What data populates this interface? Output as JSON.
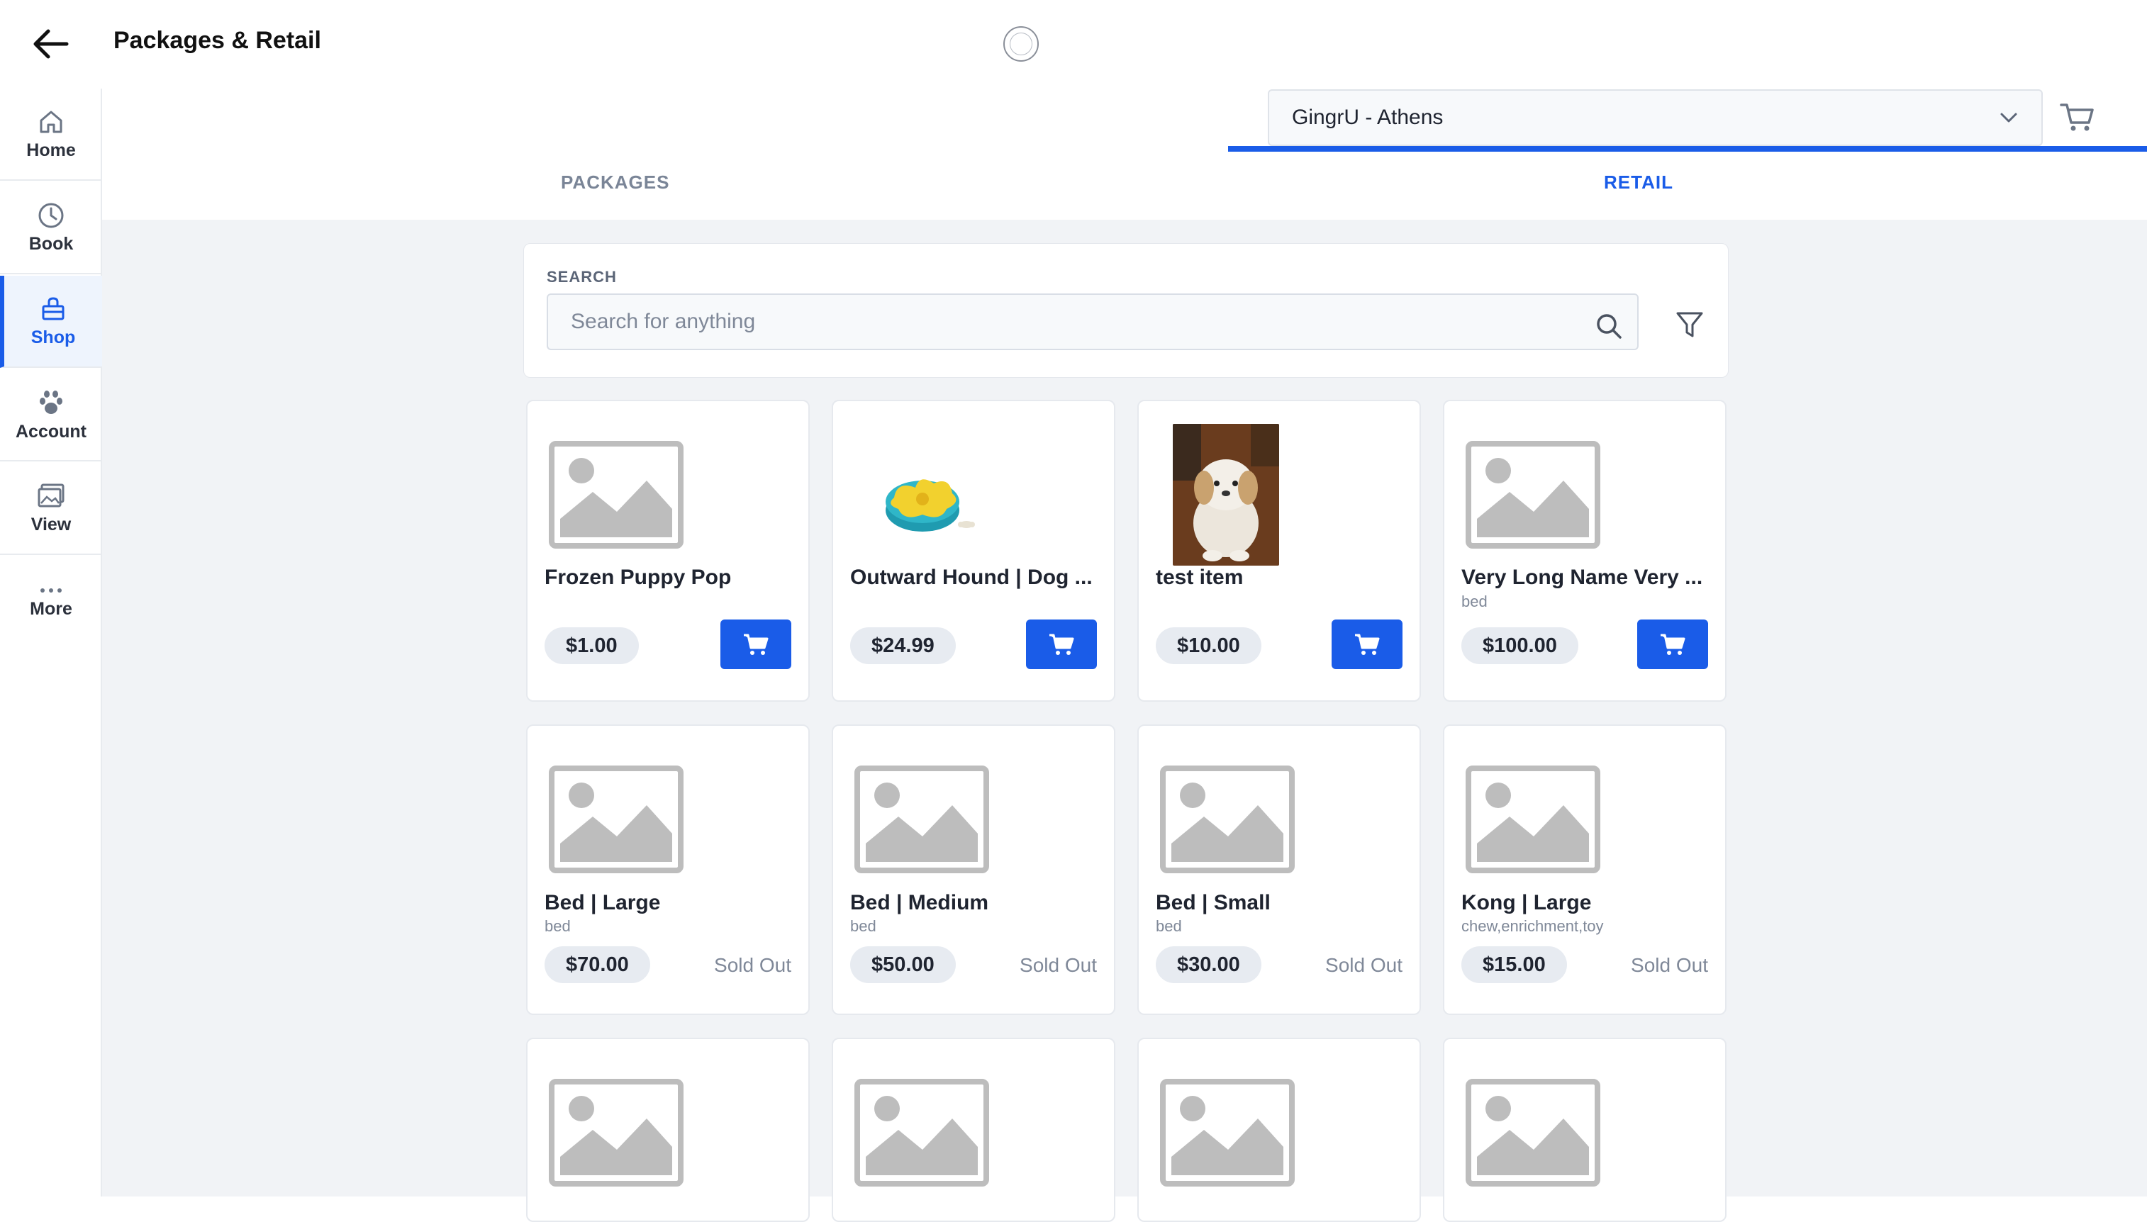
{
  "header": {
    "title": "Packages & Retail"
  },
  "location": {
    "selected": "GingrU - Athens"
  },
  "sidebar": {
    "items": [
      {
        "label": "Home",
        "icon": "home-icon"
      },
      {
        "label": "Book",
        "icon": "clock-icon"
      },
      {
        "label": "Shop",
        "icon": "shop-icon",
        "active": true
      },
      {
        "label": "Account",
        "icon": "paw-icon"
      },
      {
        "label": "View",
        "icon": "gallery-icon"
      },
      {
        "label": "More",
        "icon": "more-icon"
      }
    ]
  },
  "tabs": {
    "packages": "PACKAGES",
    "retail": "RETAIL",
    "active": "RETAIL"
  },
  "search": {
    "label": "SEARCH",
    "placeholder": "Search for anything",
    "value": ""
  },
  "products": [
    {
      "name": "Frozen Puppy Pop",
      "category": "",
      "price": "$1.00",
      "image": "placeholder",
      "available": true
    },
    {
      "name": "Outward Hound | Dog ...",
      "category": "",
      "price": "$24.99",
      "image": "toy",
      "available": true
    },
    {
      "name": "test item",
      "category": "",
      "price": "$10.00",
      "image": "dog-photo",
      "available": true
    },
    {
      "name": "Very Long Name Very ...",
      "category": "bed",
      "price": "$100.00",
      "image": "placeholder",
      "available": true
    },
    {
      "name": "Bed | Large",
      "category": "bed",
      "price": "$70.00",
      "image": "placeholder",
      "available": false,
      "status": "Sold Out"
    },
    {
      "name": "Bed | Medium",
      "category": "bed",
      "price": "$50.00",
      "image": "placeholder",
      "available": false,
      "status": "Sold Out"
    },
    {
      "name": "Bed | Small",
      "category": "bed",
      "price": "$30.00",
      "image": "placeholder",
      "available": false,
      "status": "Sold Out"
    },
    {
      "name": "Kong | Large",
      "category": "chew,enrichment,toy",
      "price": "$15.00",
      "image": "placeholder",
      "available": false,
      "status": "Sold Out"
    }
  ],
  "colors": {
    "accent": "#1a5ce8",
    "background": "#f1f3f6",
    "price_pill": "#e7ebf1",
    "placeholder": "#bdbdbd"
  }
}
